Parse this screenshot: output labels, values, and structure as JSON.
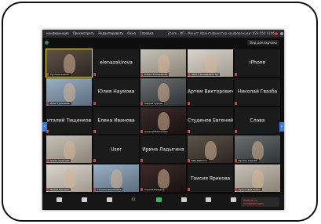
{
  "menubar": {
    "items": [
      "конференция",
      "Просмотреть",
      "Редактировать",
      "Окно",
      "Справка"
    ],
    "title": "Zoom - ИП - Минут: Идентификатор конференции: 829 550 4106"
  },
  "view_button": "Вид докладчика",
  "tiles": [
    {
      "type": "video",
      "label": "Руслана Ашкин",
      "bg": "bg1",
      "speaking": true
    },
    {
      "type": "name",
      "name": "elenazakirova"
    },
    {
      "type": "video",
      "label": "Ольга Тихомирова",
      "bg": "bg2"
    },
    {
      "type": "video",
      "label": "Авет Геннадьевич Кр",
      "bg": "bg5"
    },
    {
      "type": "name",
      "name": "iPhone"
    },
    {
      "type": "video",
      "label": "Иван Гришаева",
      "bg": "bg3"
    },
    {
      "type": "name",
      "name": "Юлия Наумова"
    },
    {
      "type": "video",
      "label": "Сергей Турчев",
      "bg": "bg4"
    },
    {
      "type": "name",
      "name": "Артем Викторович"
    },
    {
      "type": "name",
      "name": "Николай Гвазба"
    },
    {
      "type": "name",
      "name": "италий Тищенков"
    },
    {
      "type": "name",
      "name": "Елена Иванова"
    },
    {
      "type": "video",
      "label": "Алексей Митюшин",
      "bg": "bg6"
    },
    {
      "type": "name",
      "name": "Студенов Евгений"
    },
    {
      "type": "name",
      "name": "Слава"
    },
    {
      "type": "video",
      "label": "Ольга Сушкова",
      "bg": "bg2"
    },
    {
      "type": "name",
      "name": "User"
    },
    {
      "type": "name",
      "name": "Ирина Ладыгина"
    },
    {
      "type": "video",
      "label": "Mila Malinina",
      "bg": "bg1"
    },
    {
      "type": "video",
      "label": "Ерохин Сергей",
      "bg": "bg4"
    },
    {
      "type": "video",
      "label": "Лилия Турчина",
      "bg": "bg5"
    },
    {
      "type": "video",
      "label": "Татьяна Воробьёва",
      "bg": "bg3"
    },
    {
      "type": "video",
      "label": "Сергей Мазуров",
      "bg": "bg6"
    },
    {
      "type": "name",
      "name": "Таисия Ярикова"
    },
    {
      "type": "video",
      "label": "Кристофер Робин",
      "bg": "bg2"
    }
  ],
  "toolbar": {
    "participants_count": "41",
    "buttons": [
      {
        "icon": "microphone-icon",
        "caption": ""
      },
      {
        "icon": "camera-icon",
        "caption": ""
      },
      {
        "icon": "security-icon",
        "caption": ""
      },
      {
        "icon": "participants-icon",
        "caption": ""
      },
      {
        "icon": "share-screen-icon",
        "caption": ""
      },
      {
        "icon": "chat-icon",
        "caption": ""
      },
      {
        "icon": "record-icon",
        "caption": ""
      },
      {
        "icon": "reactions-icon",
        "caption": ""
      }
    ],
    "leave": "Выйти из конференции"
  }
}
